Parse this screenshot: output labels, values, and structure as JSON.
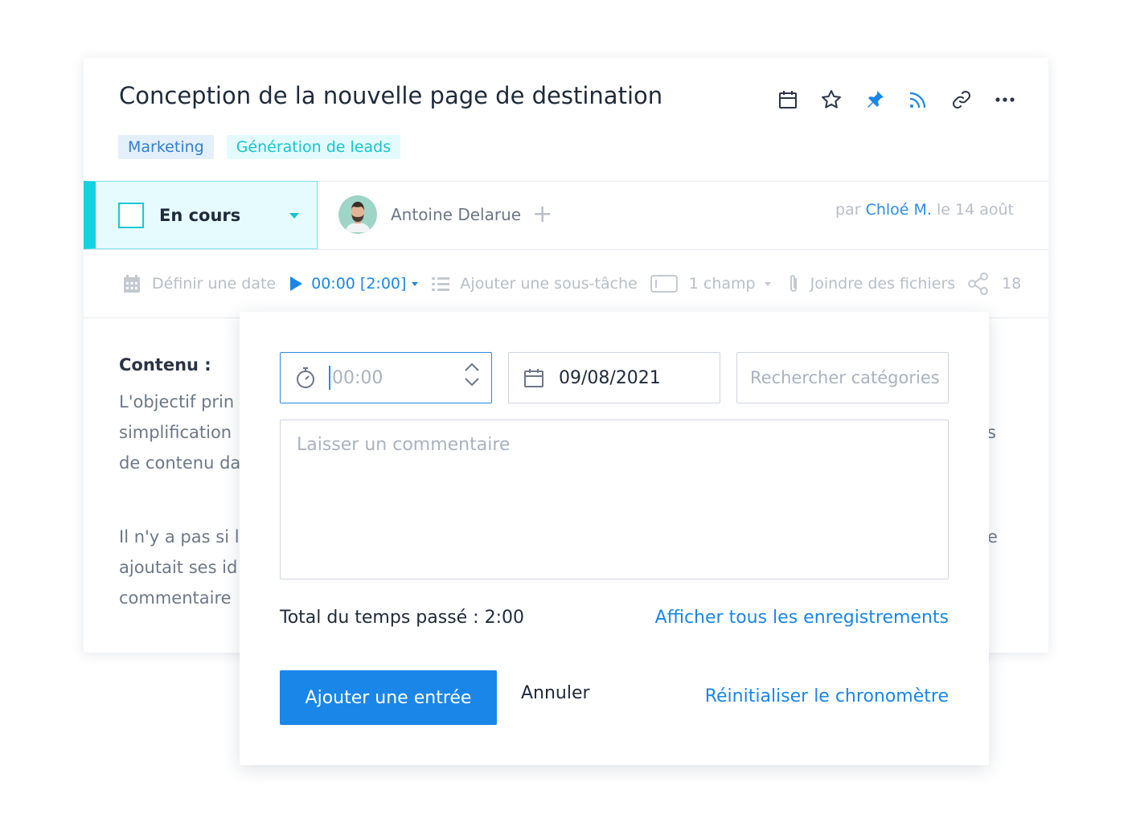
{
  "task": {
    "title": "Conception de la nouvelle page de destination",
    "tags": [
      {
        "label": "Marketing",
        "color": "#2f7fd3",
        "bg": "#e3effb"
      },
      {
        "label": "Génération de leads",
        "color": "#19c3cf",
        "bg": "#e3fbfc"
      }
    ],
    "status": {
      "label": "En cours",
      "color": "#15d2e1"
    },
    "assignee": {
      "name": "Antoine Delarue"
    },
    "byline": {
      "prefix": "par",
      "author": "Chloé M.",
      "suffix": "le 14 août"
    },
    "actions": [
      "calendar-icon",
      "star-icon",
      "pin-icon",
      "rss-icon",
      "link-icon",
      "more-icon"
    ]
  },
  "toolbar": {
    "set_date": "Définir une date",
    "timer": "00:00 [2:00]",
    "subtask": "Ajouter une sous-tâche",
    "field": "1 champ",
    "attach": "Joindre des fichiers",
    "share_count": "18"
  },
  "content": {
    "heading": "Contenu :",
    "lines": [
      "L'objectif prin",
      "simplification",
      "de contenu da",
      "Il n'y a pas si l",
      "ajoutait ses id",
      "commentaire"
    ],
    "right_fragments": [
      "s",
      "e"
    ]
  },
  "popup": {
    "time_placeholder": "00:00",
    "date_value": "09/08/2021",
    "category_placeholder": "Rechercher catégories",
    "comment_placeholder": "Laisser un commentaire",
    "total_label": "Total du temps passé : 2:00",
    "show_all": "Afficher tous les enregistrements",
    "add_entry": "Ajouter une entrée",
    "cancel": "Annuler",
    "reset": "Réinitialiser le chronomètre"
  },
  "colors": {
    "accent": "#1a86e8",
    "teal": "#15d2e1",
    "muted": "#b8bec7"
  }
}
